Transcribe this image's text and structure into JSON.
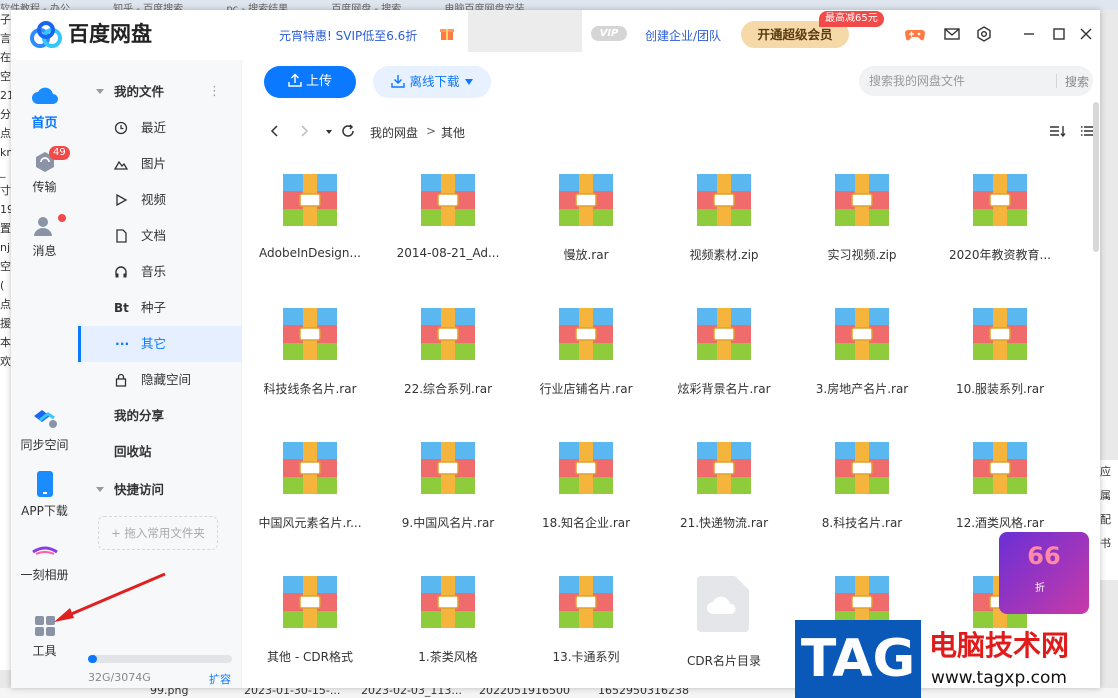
{
  "window": {
    "app_title": "百度网盘",
    "promo_text": "元宵特惠! SVIP低至6.6折",
    "vip_badge": "VIP",
    "enterprise_link": "创建企业/团队",
    "upgrade_button": "开通超级会员",
    "discount_badge": "最高减65元"
  },
  "rail": {
    "home": "首页",
    "transfer": "传输",
    "transfer_badge": "49",
    "messages": "消息",
    "sync": "同步空间",
    "app_download": "APP下载",
    "album": "一刻相册",
    "tools": "工具"
  },
  "nav": {
    "my_files": "我的文件",
    "recent": "最近",
    "images": "图片",
    "video": "视频",
    "docs": "文档",
    "music": "音乐",
    "torrent_icon": "Bt",
    "torrent": "种子",
    "other": "其它",
    "hidden": "隐藏空间",
    "my_share": "我的分享",
    "recycle": "回收站",
    "quick_access": "快捷访问",
    "drag_hint": "+ 拖入常用文件夹",
    "storage": "32G/3074G",
    "storage_used_fraction": 0.0104,
    "expand": "扩容"
  },
  "toolbar": {
    "upload": "上传",
    "offline_download": "离线下载",
    "search_placeholder": "搜索我的网盘文件",
    "search_button": "搜索"
  },
  "breadcrumb": {
    "root": "我的网盘",
    "separator": ">",
    "current": "其他"
  },
  "files": [
    {
      "name": "AdobeInDesign...",
      "type": "archive"
    },
    {
      "name": "2014-08-21_Ad...",
      "type": "archive"
    },
    {
      "name": "慢放.rar",
      "type": "archive"
    },
    {
      "name": "视频素材.zip",
      "type": "archive"
    },
    {
      "name": "实习视频.zip",
      "type": "archive"
    },
    {
      "name": "2020年教资教育...",
      "type": "archive"
    },
    {
      "name": "科技线条名片.rar",
      "type": "archive"
    },
    {
      "name": "22.综合系列.rar",
      "type": "archive"
    },
    {
      "name": "行业店铺名片.rar",
      "type": "archive"
    },
    {
      "name": "炫彩背景名片.rar",
      "type": "archive"
    },
    {
      "name": "3.房地产名片.rar",
      "type": "archive"
    },
    {
      "name": "10.服装系列.rar",
      "type": "archive"
    },
    {
      "name": "中国风元素名片.r...",
      "type": "archive"
    },
    {
      "name": "9.中国风名片.rar",
      "type": "archive"
    },
    {
      "name": "18.知名企业.rar",
      "type": "archive"
    },
    {
      "name": "21.快递物流.rar",
      "type": "archive"
    },
    {
      "name": "8.科技名片.rar",
      "type": "archive"
    },
    {
      "name": "12.酒类风格.rar",
      "type": "archive"
    },
    {
      "name": "其他 - CDR格式",
      "type": "archive"
    },
    {
      "name": "1.茶类风格",
      "type": "archive"
    },
    {
      "name": "13.卡通系列",
      "type": "archive"
    },
    {
      "name": "CDR名片目录",
      "type": "cloud"
    },
    {
      "name": "",
      "type": "archive"
    },
    {
      "name": "",
      "type": "archive"
    }
  ],
  "overlays": {
    "promo_66": "66",
    "promo_66_sub": "折",
    "watermark_tag": "TAG",
    "watermark_title": "电脑技术网",
    "watermark_url": "www.tagxp.com"
  },
  "background": {
    "tabs": [
      "软件教程 - 办公",
      "知乎 - 百度搜索",
      "pc - 搜索结果",
      "百度网盘 - 搜索",
      "电脑百度网盘安装"
    ],
    "left_fragments": [
      "子",
      "",
      "言",
      "在",
      "",
      "空",
      "21",
      "分",
      "点",
      "kn",
      "",
      "_",
      "寸",
      "19",
      "",
      "置",
      "nj",
      "",
      "空",
      "(",
      "点",
      "援",
      "",
      "",
      "本",
      "欢"
    ],
    "bottom_cells": [
      "99.png",
      "2023-01-30-15-...",
      "2023-02-03_113...",
      "20220519165​00",
      "1652950316238"
    ]
  },
  "colors": {
    "accent": "#0a78ff",
    "danger": "#f24949",
    "gold": "#f6d9a8"
  }
}
